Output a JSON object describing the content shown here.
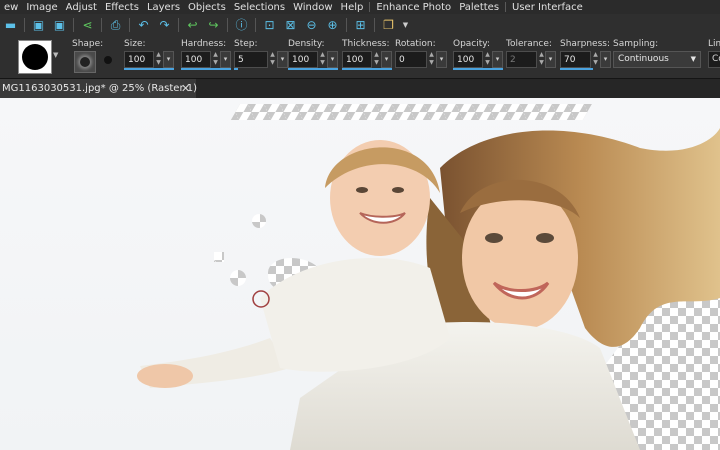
{
  "menu": [
    "ew",
    "Image",
    "Adjust",
    "Effects",
    "Layers",
    "Objects",
    "Selections",
    "Window",
    "Help",
    "Enhance Photo",
    "Palettes",
    "User Interface"
  ],
  "options": {
    "shape_label": "Shape:",
    "size": {
      "label": "Size:",
      "value": "100"
    },
    "hardness": {
      "label": "Hardness:",
      "value": "100"
    },
    "step": {
      "label": "Step:",
      "value": "5"
    },
    "density": {
      "label": "Density:",
      "value": "100"
    },
    "thickness": {
      "label": "Thickness:",
      "value": "100"
    },
    "rotation": {
      "label": "Rotation:",
      "value": "0"
    },
    "opacity": {
      "label": "Opacity:",
      "value": "100"
    },
    "tolerance": {
      "label": "Tolerance:",
      "value": "2"
    },
    "sharpness": {
      "label": "Sharpness:",
      "value": "70"
    },
    "sampling": {
      "label": "Sampling:",
      "value": "Continuous"
    },
    "overflow": {
      "label": "Lim",
      "value": "Co"
    }
  },
  "document_tab": {
    "title": "MG1163030531.jpg* @  25% (Raster 1)",
    "close": "✕"
  },
  "colors": {
    "accent": "#4aa3df",
    "toolbar_icon": "#5cc0e8"
  },
  "icons": {
    "brush_cursor": "brush-cursor-icon"
  }
}
